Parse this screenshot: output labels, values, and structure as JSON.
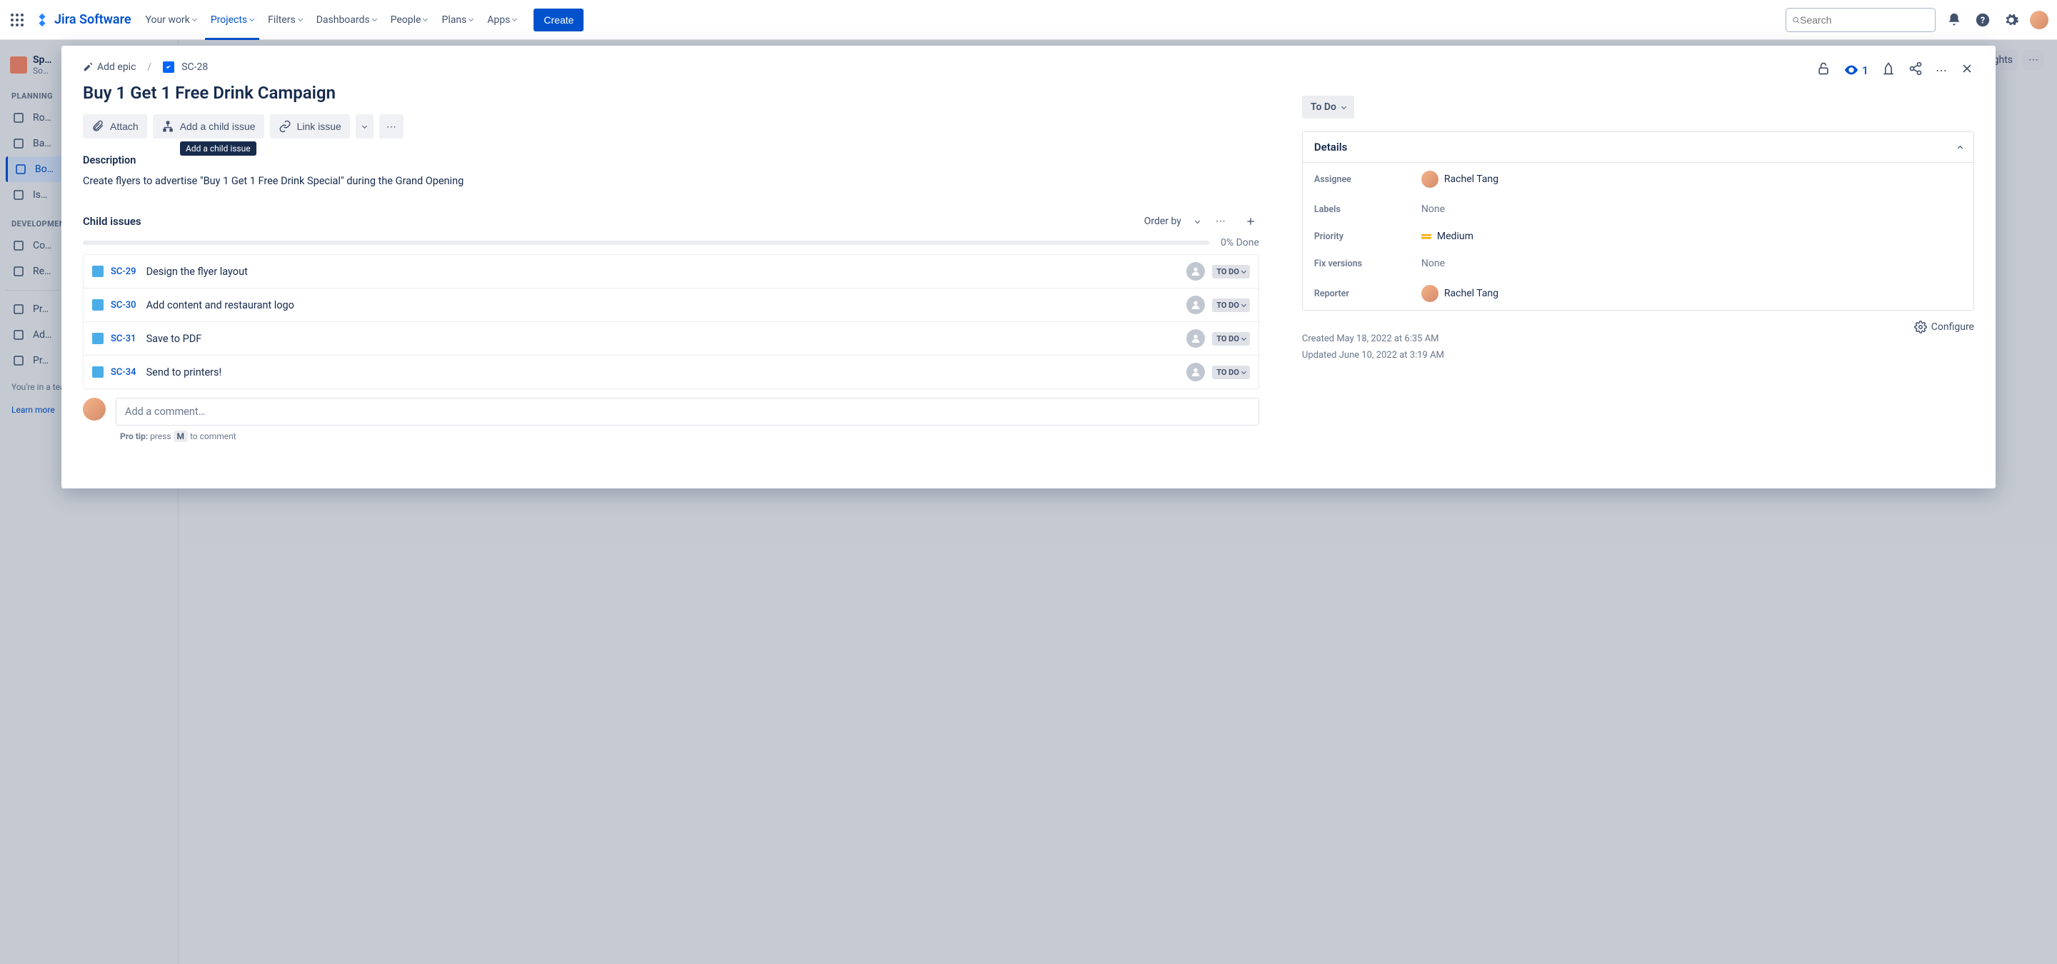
{
  "topnav": {
    "logo": "Jira Software",
    "items": [
      "Your work",
      "Projects",
      "Filters",
      "Dashboards",
      "People",
      "Plans",
      "Apps"
    ],
    "active_index": 1,
    "create_label": "Create",
    "search_placeholder": "Search"
  },
  "sidebar": {
    "project_name": "Sp…",
    "project_sub": "So…",
    "planning_label": "PLANNING",
    "planning_items": [
      "Ro…",
      "Ba…",
      "Bo…",
      "Is…"
    ],
    "planning_active_index": 2,
    "dev_label": "DEVELOPMENT",
    "dev_items": [
      "Co…",
      "Re…"
    ],
    "other_items": [
      "Pr…",
      "Ad…",
      "Pr…"
    ],
    "footer": "You're in a team-managed project",
    "learn_more": "Learn more"
  },
  "page_actions": {
    "insights": "Insights"
  },
  "modal": {
    "add_epic": "Add epic",
    "issue_key": "SC-28",
    "title": "Buy 1 Get 1 Free Drink Campaign",
    "attach": "Attach",
    "add_child": "Add a child issue",
    "link_issue": "Link issue",
    "tooltip": "Add a child issue",
    "description_label": "Description",
    "description_text": "Create flyers to advertise \"Buy 1 Get 1 Free Drink Special\" during the Grand Opening",
    "child_issues_label": "Child issues",
    "order_by": "Order by",
    "progress_pct": "0% Done",
    "children": [
      {
        "key": "SC-29",
        "summary": "Design the flyer layout",
        "status": "TO DO"
      },
      {
        "key": "SC-30",
        "summary": "Add content and restaurant logo",
        "status": "TO DO"
      },
      {
        "key": "SC-31",
        "summary": "Save to PDF",
        "status": "TO DO"
      },
      {
        "key": "SC-34",
        "summary": "Send to printers!",
        "status": "TO DO"
      }
    ],
    "comment_placeholder": "Add a comment…",
    "protip_label": "Pro tip:",
    "protip_press": "press",
    "protip_key": "M",
    "protip_rest": "to comment",
    "watch_count": "1",
    "status": "To Do",
    "details_label": "Details",
    "details": {
      "assignee_label": "Assignee",
      "assignee": "Rachel Tang",
      "labels_label": "Labels",
      "labels": "None",
      "priority_label": "Priority",
      "priority": "Medium",
      "fix_label": "Fix versions",
      "fix": "None",
      "reporter_label": "Reporter",
      "reporter": "Rachel Tang"
    },
    "created": "Created May 18, 2022 at 6:35 AM",
    "updated": "Updated June 10, 2022 at 3:19 AM",
    "configure": "Configure"
  }
}
